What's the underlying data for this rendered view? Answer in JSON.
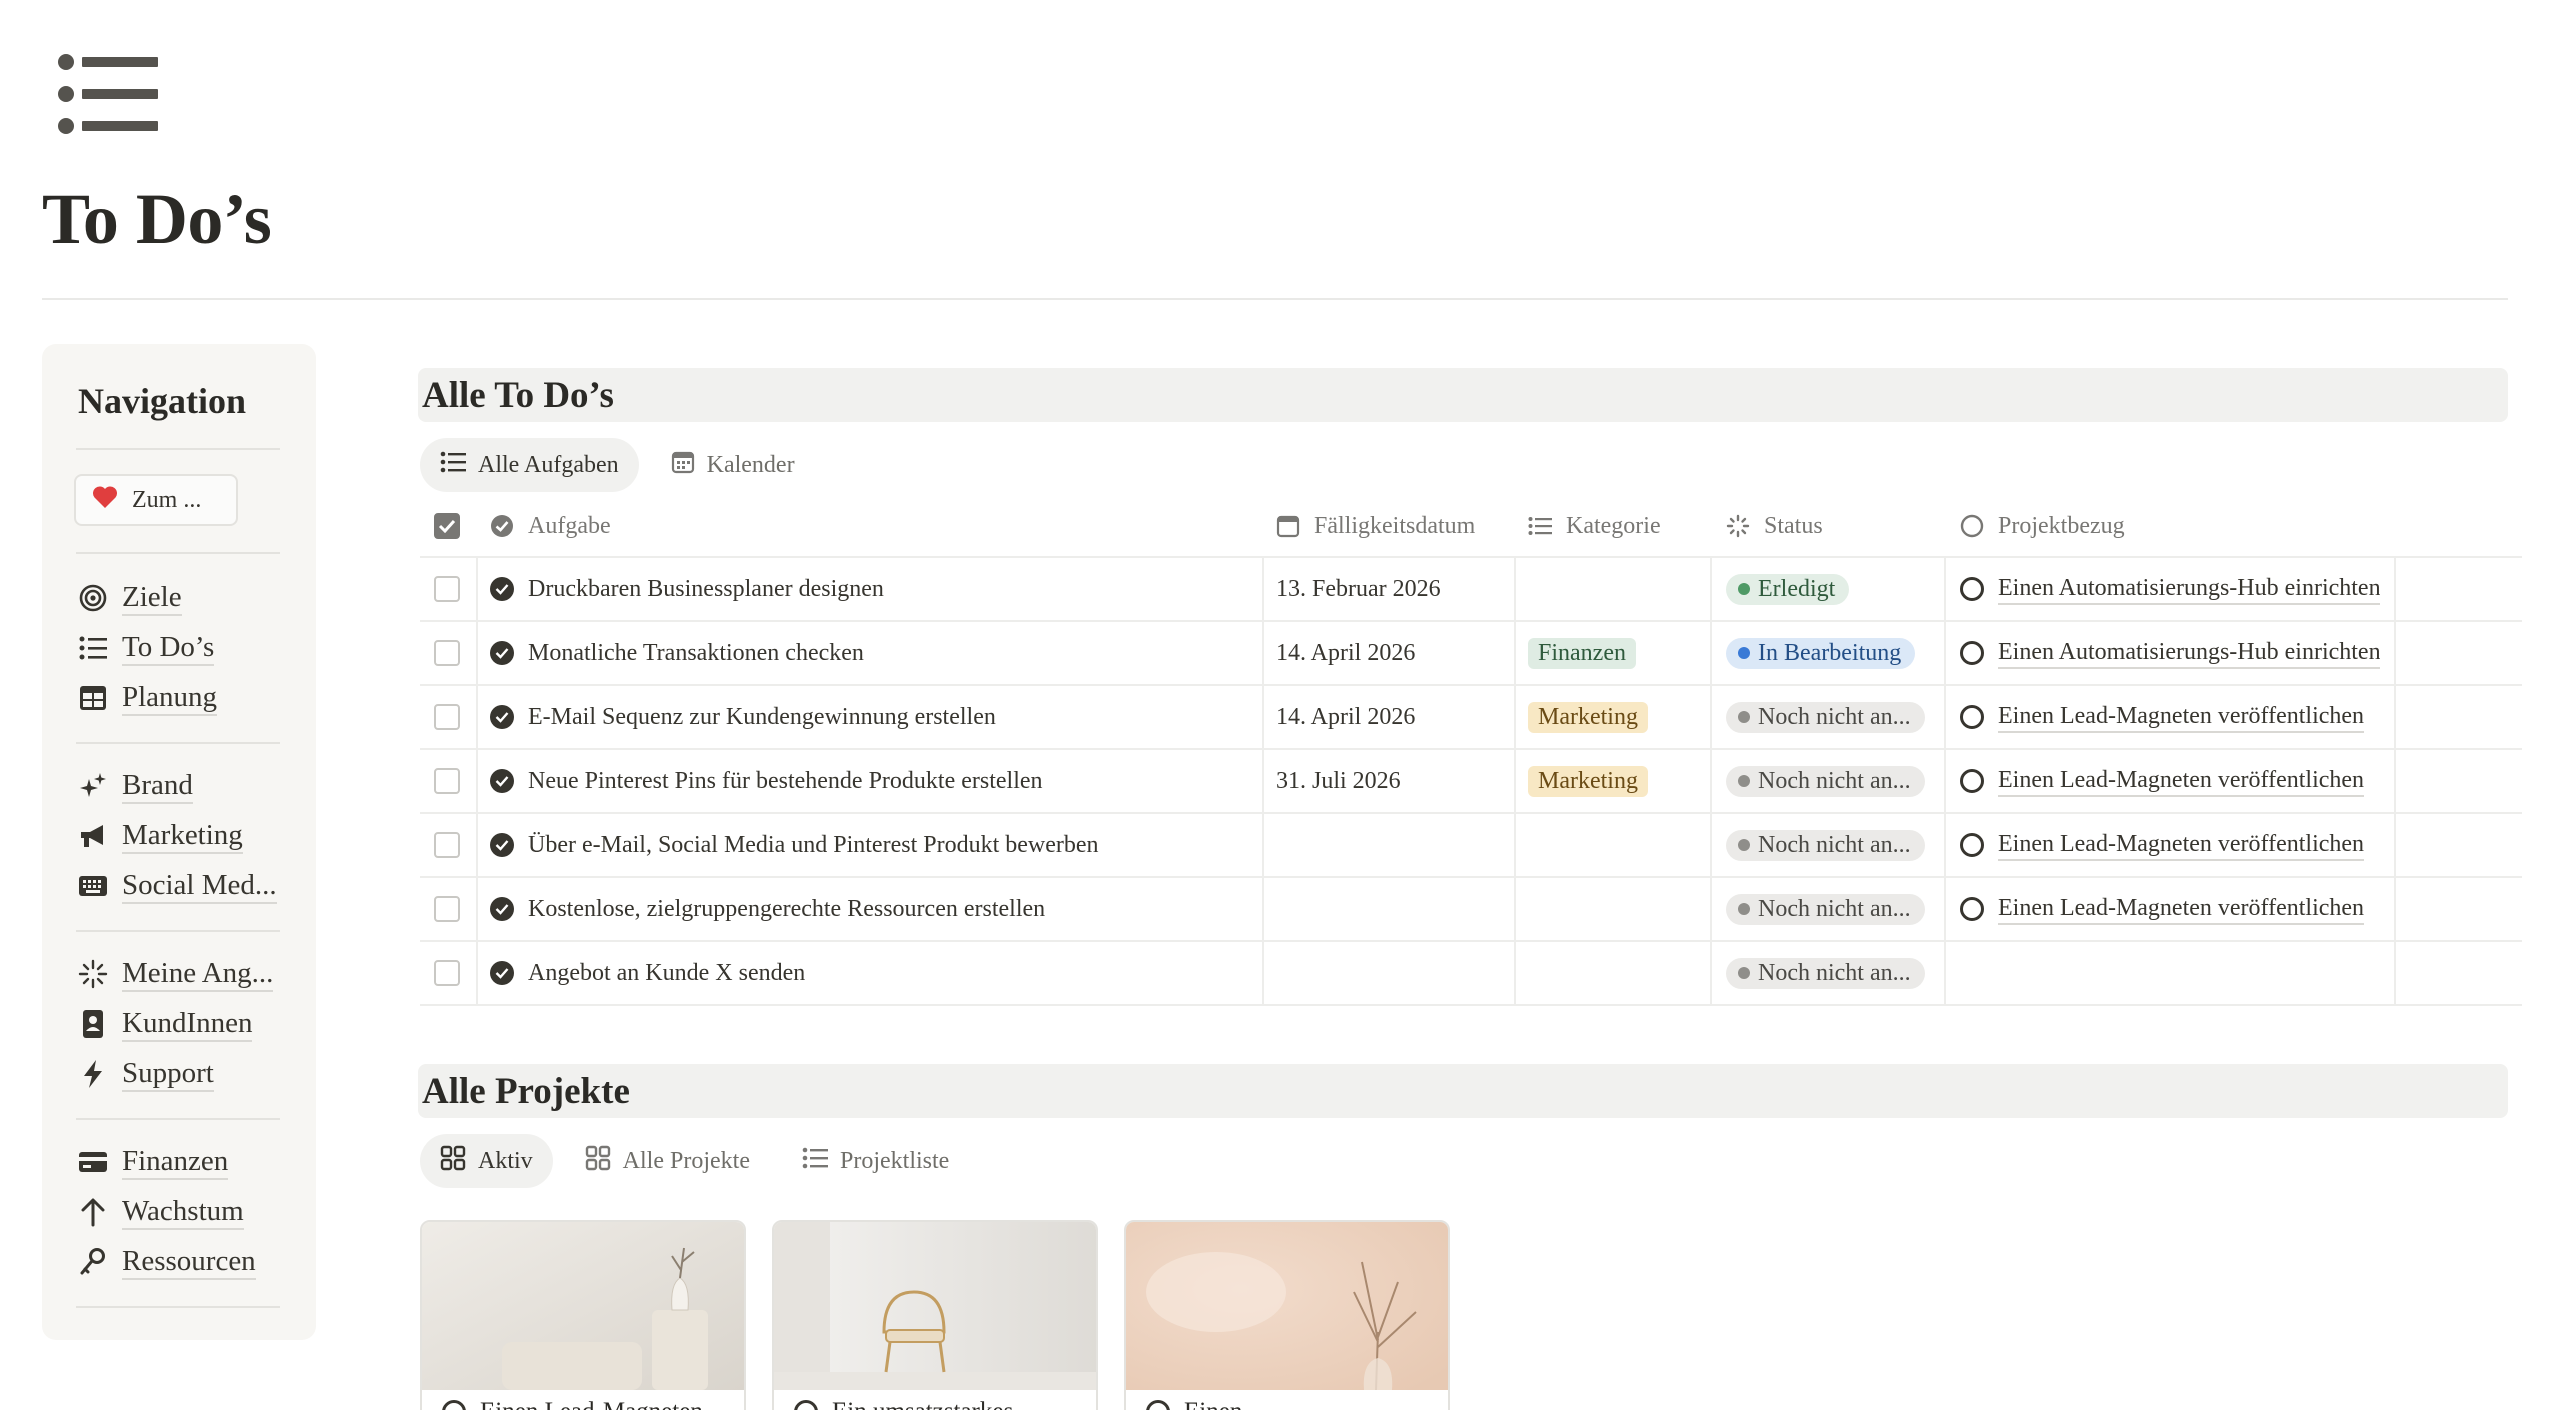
{
  "page": {
    "title": "To Do’s",
    "icon": "bulleted-list-icon"
  },
  "sidebar": {
    "title": "Navigation",
    "button": {
      "icon": "heart-icon",
      "label": "Zum ..."
    },
    "groups": [
      [
        {
          "icon": "target-icon",
          "label": "Ziele"
        },
        {
          "icon": "list-icon",
          "label": "To Do’s"
        },
        {
          "icon": "table-icon",
          "label": "Planung"
        }
      ],
      [
        {
          "icon": "sparkle-icon",
          "label": "Brand"
        },
        {
          "icon": "megaphone-icon",
          "label": "Marketing"
        },
        {
          "icon": "keyboard-icon",
          "label": "Social Med..."
        }
      ],
      [
        {
          "icon": "sparkle-burst-icon",
          "label": "Meine Ang..."
        },
        {
          "icon": "contact-book-icon",
          "label": "KundInnen"
        },
        {
          "icon": "lightning-icon",
          "label": "Support"
        }
      ],
      [
        {
          "icon": "credit-card-icon",
          "label": "Finanzen"
        },
        {
          "icon": "arrow-up-icon",
          "label": "Wachstum"
        },
        {
          "icon": "key-icon",
          "label": "Ressourcen"
        }
      ]
    ]
  },
  "todos": {
    "section_title": "Alle To Do’s",
    "tabs": [
      {
        "icon": "list-icon",
        "label": "Alle Aufgaben",
        "active": true
      },
      {
        "icon": "calendar-icon",
        "label": "Kalender",
        "active": false
      }
    ],
    "columns": {
      "task": "Aufgabe",
      "due": "Fälligkeitsdatum",
      "category": "Kategorie",
      "status": "Status",
      "project": "Projektbezug"
    },
    "rows": [
      {
        "task": "Druckbaren Businessplaner designen",
        "due": "13. Februar 2026",
        "category": "",
        "status": "Erledigt",
        "status_color": "green",
        "project": "Einen Automatisierungs-Hub einrichten"
      },
      {
        "task": "Monatliche Transaktionen checken",
        "due": "14. April 2026",
        "category": "Finanzen",
        "status": "In Bearbeitung",
        "status_color": "blue",
        "project": "Einen Automatisierungs-Hub einrichten"
      },
      {
        "task": "E-Mail Sequenz zur Kundengewinnung erstellen",
        "due": "14. April 2026",
        "category": "Marketing",
        "status": "Noch nicht an...",
        "status_color": "gray",
        "project": "Einen Lead-Magneten veröffentlichen"
      },
      {
        "task": "Neue Pinterest Pins für bestehende Produkte erstellen",
        "due": "31. Juli 2026",
        "category": "Marketing",
        "status": "Noch nicht an...",
        "status_color": "gray",
        "project": "Einen Lead-Magneten veröffentlichen"
      },
      {
        "task": "Über e-Mail, Social Media und Pinterest Produkt bewerben",
        "due": "",
        "category": "",
        "status": "Noch nicht an...",
        "status_color": "gray",
        "project": "Einen Lead-Magneten veröffentlichen"
      },
      {
        "task": "Kostenlose, zielgruppengerechte Ressourcen erstellen",
        "due": "",
        "category": "",
        "status": "Noch nicht an...",
        "status_color": "gray",
        "project": "Einen Lead-Magneten veröffentlichen"
      },
      {
        "task": "Angebot an Kunde X senden",
        "due": "",
        "category": "",
        "status": "Noch nicht an...",
        "status_color": "gray",
        "project": ""
      }
    ]
  },
  "projects": {
    "section_title": "Alle Projekte",
    "tabs": [
      {
        "icon": "gallery-icon",
        "label": "Aktiv",
        "active": true
      },
      {
        "icon": "gallery-icon",
        "label": "Alle Projekte",
        "active": false
      },
      {
        "icon": "list-icon",
        "label": "Projektliste",
        "active": false
      }
    ],
    "cards": [
      {
        "title": "Einen Lead-Magneten"
      },
      {
        "title": "Ein umsatzstarkes"
      },
      {
        "title": "Einen"
      }
    ]
  },
  "colors": {
    "text": "#37352f",
    "muted": "#787774",
    "sidebar_bg": "#f7f6f3",
    "section_bg": "#f1f1ef",
    "heart": "#e03e3e"
  }
}
